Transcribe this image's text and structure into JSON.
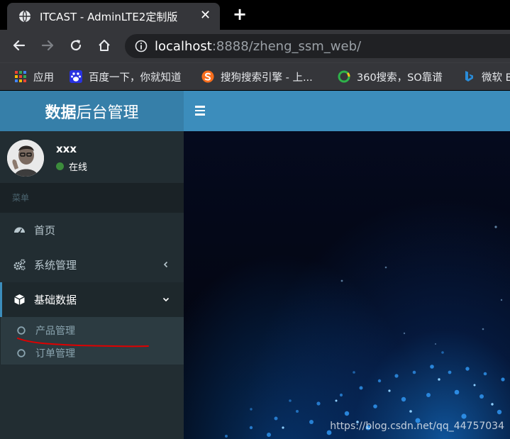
{
  "browser": {
    "tab": {
      "title": "ITCAST - AdminLTE2定制版",
      "close_glyph": "✕"
    },
    "new_tab_glyph": "+",
    "url": {
      "host": "localhost",
      "rest": ":8888/zheng_ssm_web/"
    },
    "bookmarks": [
      {
        "label": "应用",
        "icon": "apps-grid-icon"
      },
      {
        "label": "百度一下，你就知道",
        "icon": "baidu-paw-icon"
      },
      {
        "label": "搜狗搜索引擎 - 上...",
        "icon": "sogou-icon"
      },
      {
        "label": "360搜索，SO靠谱",
        "icon": "360-search-icon"
      },
      {
        "label": "微软 B",
        "icon": "bing-icon"
      }
    ]
  },
  "app": {
    "logo": {
      "bold": "数据",
      "rest": "后台管理"
    },
    "user": {
      "name": "xxx",
      "status": "在线",
      "status_color": "#3c8c3c"
    },
    "menu_header": "菜单",
    "menu": [
      {
        "label": "首页",
        "icon": "dashboard-icon"
      },
      {
        "label": "系统管理",
        "icon": "cogs-icon",
        "chevron": "left"
      },
      {
        "label": "基础数据",
        "icon": "cube-icon",
        "chevron": "down",
        "active": true
      }
    ],
    "submenu": [
      {
        "label": "产品管理",
        "icon": "circle-icon"
      },
      {
        "label": "订单管理",
        "icon": "circle-icon"
      }
    ]
  },
  "watermark": "https://blog.csdn.net/qq_44757034",
  "colors": {
    "navbar": "#3c8dbc",
    "logo_bg": "#367fa9",
    "sidebar_bg": "#222d32",
    "annotation_red": "#e00000"
  }
}
